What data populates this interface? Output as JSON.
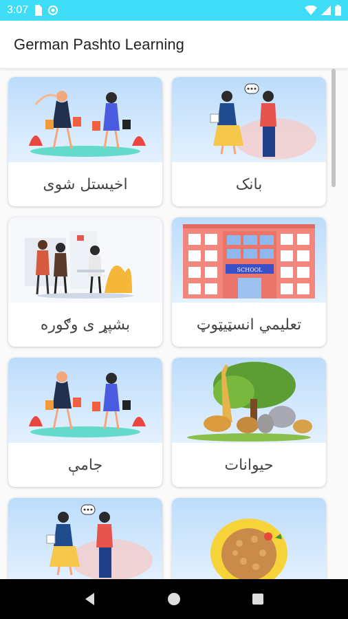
{
  "status_bar": {
    "time": "3:07",
    "icons": [
      "sim-card-icon",
      "data-saver-icon",
      "wifi-icon",
      "signal-icon",
      "battery-icon"
    ]
  },
  "app_bar": {
    "title": "German Pashto Learning"
  },
  "categories": [
    {
      "label": "اخیستل شوی",
      "image": "shopping-illustration"
    },
    {
      "label": "بانک",
      "image": "conversation-illustration"
    },
    {
      "label": "بشپړ ی وګوره",
      "image": "office-meeting-illustration"
    },
    {
      "label": "تعلیمي انسټیټوټ",
      "image": "school-building-illustration"
    },
    {
      "label": "جامې",
      "image": "shopping-illustration"
    },
    {
      "label": "حیوانات",
      "image": "animals-illustration"
    },
    {
      "label": "",
      "image": "conversation-illustration"
    },
    {
      "label": "",
      "image": "food-plate-illustration"
    }
  ],
  "nav_bar": {
    "buttons": [
      "back-icon",
      "home-icon",
      "recents-icon"
    ]
  },
  "colors": {
    "status_bar": "#3fdcf5",
    "card_sky": "#bcdcfb",
    "nav_bar": "#000000"
  }
}
